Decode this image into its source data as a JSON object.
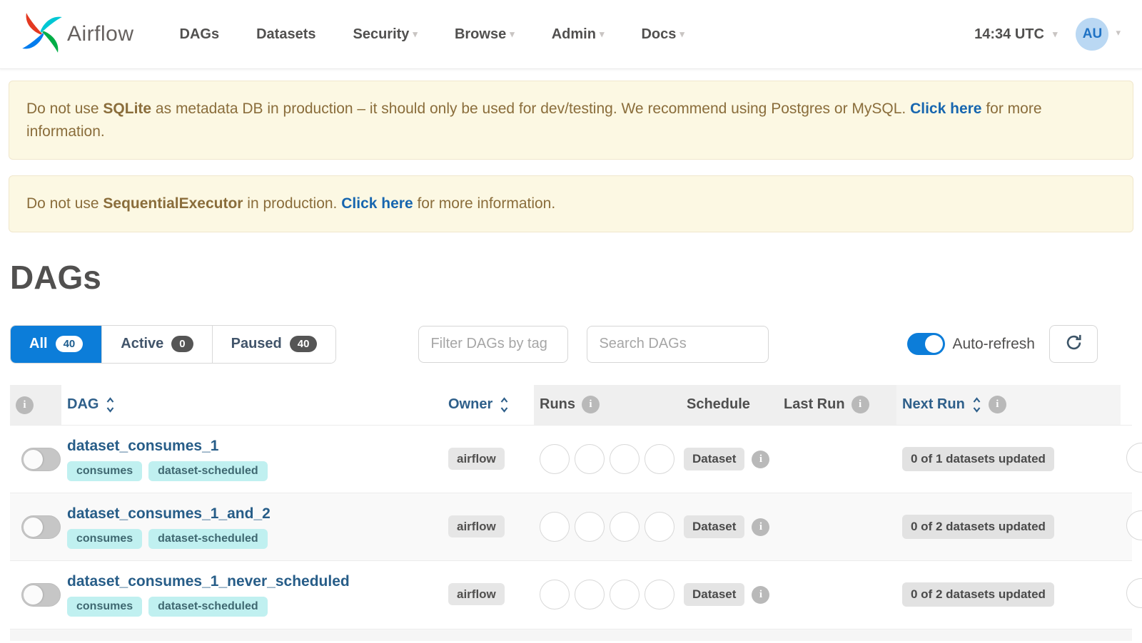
{
  "navbar": {
    "brand": "Airflow",
    "items": [
      {
        "label": "DAGs"
      },
      {
        "label": "Datasets"
      },
      {
        "label": "Security"
      },
      {
        "label": "Browse"
      },
      {
        "label": "Admin"
      },
      {
        "label": "Docs"
      }
    ],
    "clock": "14:34 UTC",
    "user_initials": "AU"
  },
  "alerts": [
    {
      "prefix": "Do not use ",
      "strong": "SQLite",
      "middle": " as metadata DB in production – it should only be used for dev/testing. We recommend using Postgres or MySQL. ",
      "link": "Click here",
      "suffix": " for more information."
    },
    {
      "prefix": "Do not use ",
      "strong": "SequentialExecutor",
      "middle": " in production. ",
      "link": "Click here",
      "suffix": " for more information."
    }
  ],
  "page": {
    "title": "DAGs"
  },
  "toolbar": {
    "tabs": [
      {
        "label": "All",
        "count": "40"
      },
      {
        "label": "Active",
        "count": "0"
      },
      {
        "label": "Paused",
        "count": "40"
      }
    ],
    "tag_filter_placeholder": "Filter DAGs by tag",
    "search_placeholder": "Search DAGs",
    "auto_refresh_label": "Auto-refresh",
    "auto_refresh_on": true
  },
  "table": {
    "headers": {
      "dag": "DAG",
      "owner": "Owner",
      "runs": "Runs",
      "schedule": "Schedule",
      "last_run": "Last Run",
      "next_run": "Next Run"
    },
    "rows": [
      {
        "name": "dataset_consumes_1",
        "tags": [
          "consumes",
          "dataset-scheduled"
        ],
        "owner": "airflow",
        "paused": true,
        "schedule": "Dataset",
        "last_run": "",
        "next_run": "0 of 1 datasets updated"
      },
      {
        "name": "dataset_consumes_1_and_2",
        "tags": [
          "consumes",
          "dataset-scheduled"
        ],
        "owner": "airflow",
        "paused": true,
        "schedule": "Dataset",
        "last_run": "",
        "next_run": "0 of 2 datasets updated"
      },
      {
        "name": "dataset_consumes_1_never_scheduled",
        "tags": [
          "consumes",
          "dataset-scheduled"
        ],
        "owner": "airflow",
        "paused": true,
        "schedule": "Dataset",
        "last_run": "",
        "next_run": "0 of 2 datasets updated"
      }
    ]
  },
  "colors": {
    "accent_blue": "#0c7dd9",
    "logo_red": "#E43921",
    "logo_teal": "#00C7D4",
    "logo_green": "#00AD46",
    "logo_blue": "#017CEE",
    "alert_bg": "#fcf8e3",
    "alert_text": "#8a6d3b",
    "alert_link": "#1766af",
    "tag_bg": "#c0f0f0",
    "tag_text": "#3f6871",
    "badge_gray_bg": "#e3e3e3",
    "nav_text": "#51504f",
    "sortable_header": "#2e5f8a",
    "dag_link": "#275d88",
    "avatar_bg": "#bad8f3",
    "avatar_text": "#1f72c4"
  }
}
